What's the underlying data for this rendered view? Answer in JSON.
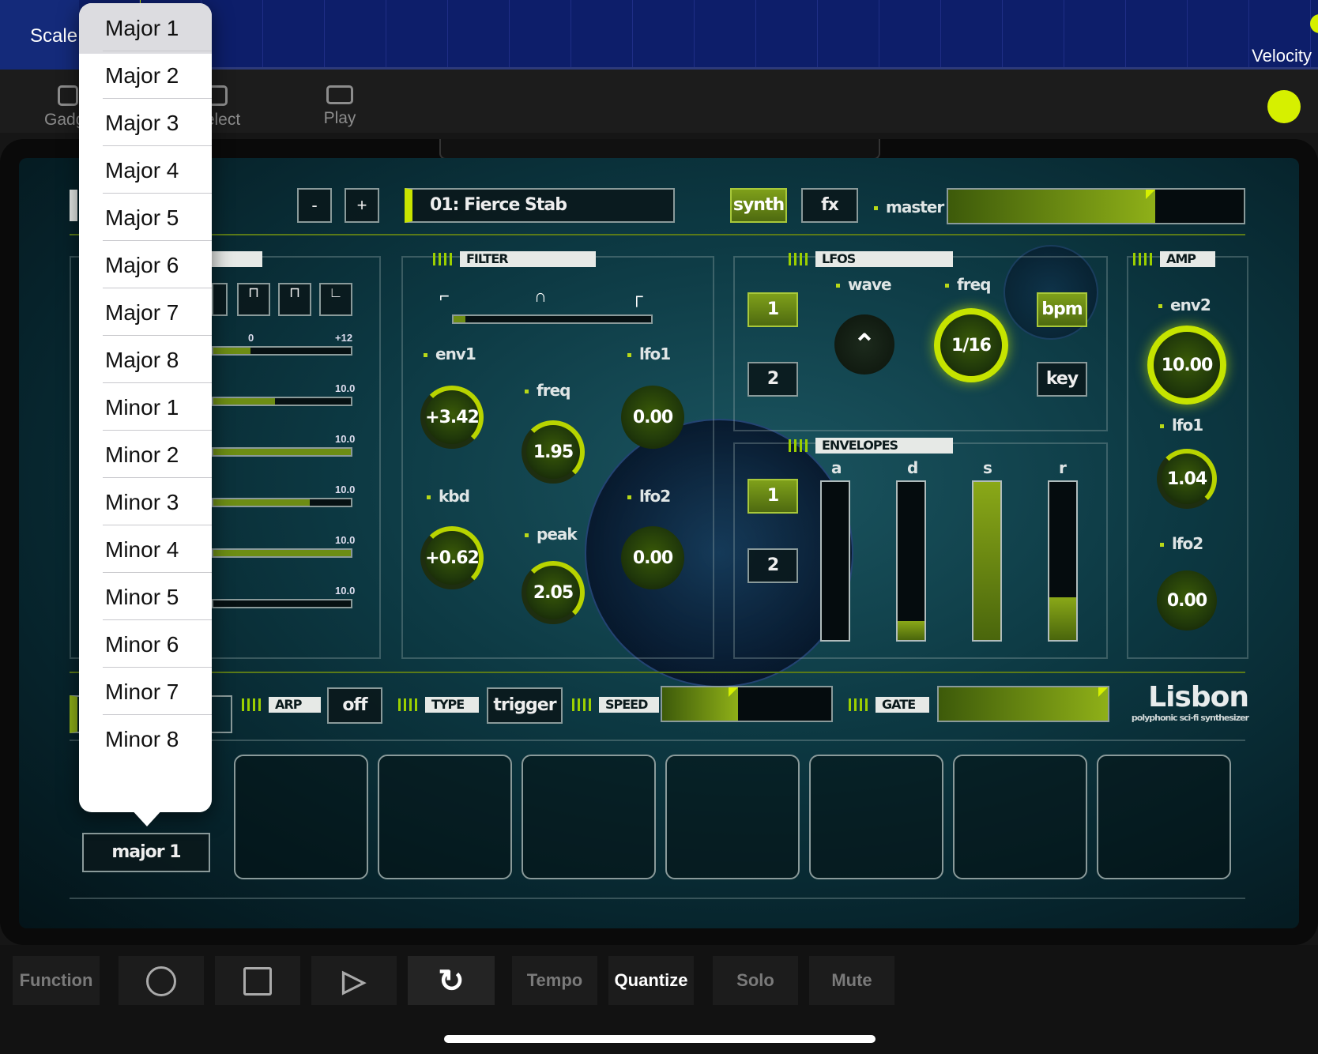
{
  "topbar": {
    "scale_label": "Scale",
    "velocity_label": "Velocity"
  },
  "toolbar": {
    "items": [
      {
        "label": "Gadget"
      },
      {
        "label": "Select"
      },
      {
        "label": "Play"
      }
    ]
  },
  "preset": {
    "minus": "-",
    "plus": "+",
    "name": "01: Fierce Stab"
  },
  "mode_tabs": {
    "synth": "synth",
    "fx": "fx",
    "master_label": "master",
    "master_level": 0.7
  },
  "filter": {
    "title": "FILTER",
    "slider_level": 0.06,
    "env1": {
      "label": "env1",
      "value": "+3.42"
    },
    "kbd": {
      "label": "kbd",
      "value": "+0.62"
    },
    "freq": {
      "label": "freq",
      "value": "1.95"
    },
    "peak": {
      "label": "peak",
      "value": "2.05"
    },
    "lfo1": {
      "label": "lfo1",
      "value": "0.00"
    },
    "lfo2": {
      "label": "lfo2",
      "value": "0.00"
    }
  },
  "lfos": {
    "title": "LFOS",
    "sel_1": "1",
    "sel_2": "2",
    "wave_label": "wave",
    "freq_label": "freq",
    "freq_value": "1/16",
    "bpm": "bpm",
    "key": "key"
  },
  "envelopes": {
    "title": "ENVELOPES",
    "sel_1": "1",
    "sel_2": "2",
    "a": {
      "label": "a",
      "level": 0.0
    },
    "d": {
      "label": "d",
      "level": 0.12
    },
    "s": {
      "label": "s",
      "level": 1.0
    },
    "r": {
      "label": "r",
      "level": 0.27
    }
  },
  "amp": {
    "title": "AMP",
    "env2": {
      "label": "env2",
      "value": "10.00"
    },
    "lfo1": {
      "label": "lfo1",
      "value": "1.04"
    },
    "lfo2": {
      "label": "lfo2",
      "value": "0.00"
    }
  },
  "osc": {
    "pitch_min": "0",
    "pitch_max": "+12",
    "sliders": [
      {
        "max": "10.0",
        "level": 0.45
      },
      {
        "max": "10.0",
        "level": 1.0
      },
      {
        "max": "10.0",
        "level": 0.7
      },
      {
        "max": "10.0",
        "level": 1.0
      },
      {
        "max": "10.0",
        "level": 0.0
      }
    ]
  },
  "arp": {
    "arp_label": "ARP",
    "arp_value": "off",
    "type_label": "TYPE",
    "type_value": "trigger",
    "speed_label": "SPEED",
    "speed_level": 0.45,
    "gate_label": "GATE",
    "gate_level": 1.0
  },
  "brand": {
    "name": "Lisbon",
    "tagline": "polyphonic sci-fi synthesizer"
  },
  "scale_button": "major 1",
  "dropdown": {
    "selected_index": 0,
    "items": [
      "Major 1",
      "Major 2",
      "Major 3",
      "Major 4",
      "Major 5",
      "Major 6",
      "Major 7",
      "Major 8",
      "Minor 1",
      "Minor 2",
      "Minor 3",
      "Minor 4",
      "Minor 5",
      "Minor 6",
      "Minor 7",
      "Minor 8"
    ]
  },
  "bottombar": {
    "function": "Function",
    "tempo": "Tempo",
    "quantize": "Quantize",
    "solo": "Solo",
    "mute": "Mute"
  },
  "colors": {
    "accent": "#d6f000",
    "panel": "#0d3a44",
    "topstrip": "#0d1e6a"
  }
}
